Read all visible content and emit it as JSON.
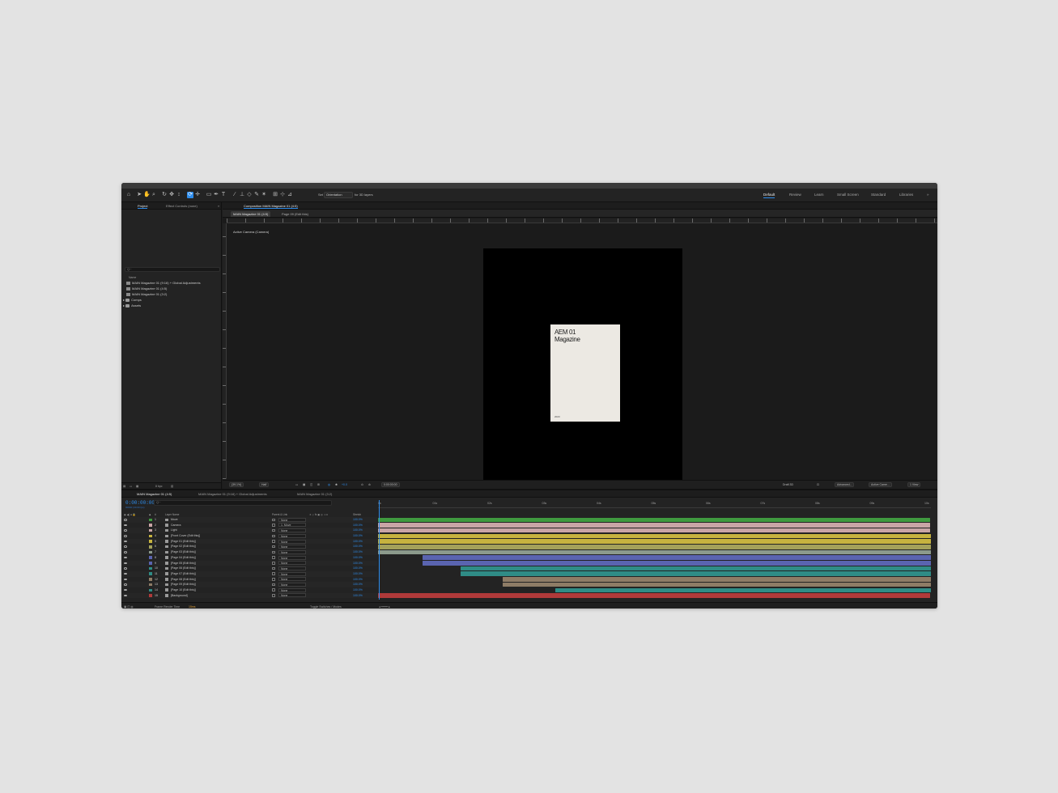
{
  "toolbar": {
    "mode_label": "Set",
    "mode_select": "Orientation",
    "mode_suffix": "for 3D layers"
  },
  "workspaces": [
    {
      "label": "Default",
      "active": true
    },
    {
      "label": "Review",
      "active": false
    },
    {
      "label": "Learn",
      "active": false
    },
    {
      "label": "Small Screen",
      "active": false
    },
    {
      "label": "Standard",
      "active": false
    },
    {
      "label": "Libraries",
      "active": false
    }
  ],
  "project": {
    "tab_project": "Project",
    "tab_effects": "Effect Controls (none)",
    "search_placeholder": "Q~",
    "name_header": "Name",
    "items": [
      {
        "label": "MAIN Magazine 01 (9:16) + Global Adjustments",
        "type": "comp"
      },
      {
        "label": "MAIN Magazine 01 (4:5)",
        "type": "comp"
      },
      {
        "label": "MAIN Magazine 01 (3:2)",
        "type": "comp"
      },
      {
        "label": "Comps",
        "type": "folder"
      },
      {
        "label": "Assets",
        "type": "folder"
      }
    ],
    "foot_bpc": "8 bpc"
  },
  "composition": {
    "panel_title": "Composition MAIN Magazine 01 (4:5)",
    "subtabs": [
      {
        "label": "MAIN Magazine 01 (4:5)",
        "active": true
      },
      {
        "label": "Page 09 (Edit this)",
        "active": false
      }
    ],
    "viewer_label": "Active Camera (Camera)",
    "magazine_title_1": "AEM 01",
    "magazine_title_2": "Magazine",
    "magazine_footer": "2023",
    "footer": {
      "zoom": "(39.1%)",
      "resolution": "Half",
      "offset": "+0.0",
      "timecode": "0:00:00:00",
      "renderer": "Draft 3D",
      "advanced": "Advanced...",
      "view": "Active Came...",
      "views": "1 View"
    }
  },
  "timeline": {
    "tabs": [
      {
        "label": "MAIN Magazine 01 (4:5)",
        "active": true
      },
      {
        "label": "MAIN Magazine 01 (9:16) + Global Adjustments",
        "active": false
      },
      {
        "label": "MAIN Magazine 01 (3:2)",
        "active": false
      }
    ],
    "timecode": "0:00:00:00",
    "fps": "00000 (30.00 fps)",
    "search_placeholder": "Q~",
    "headers": {
      "layer_name": "Layer Name",
      "parent": "Parent & Link",
      "stretch": "Stretch"
    },
    "ticks": [
      "0s",
      "01s",
      "02s",
      "03s",
      "04s",
      "05s",
      "06s",
      "07s",
      "08s",
      "09s",
      "10s"
    ],
    "layers": [
      {
        "num": "1",
        "name": "Move",
        "parent": "None",
        "stretch": "100.0%",
        "color": "#3f9a3f",
        "start": 0.0,
        "end": 0.998
      },
      {
        "num": "2",
        "name": "Camera",
        "parent": "1. Move",
        "stretch": "100.0%",
        "color": "#c9a5a6",
        "start": 0.0,
        "end": 0.998
      },
      {
        "num": "3",
        "name": "Light",
        "parent": "None",
        "stretch": "100.0%",
        "color": "#c9a5a6",
        "start": 0.0,
        "end": 0.998
      },
      {
        "num": "4",
        "name": "[Front Cover (Edit this)]",
        "parent": "None",
        "stretch": "100.0%",
        "color": "#c6b33f",
        "start": 0.0,
        "end": 1.0
      },
      {
        "num": "5",
        "name": "[Page 01 (Edit this)]",
        "parent": "None",
        "stretch": "100.0%",
        "color": "#c6b33f",
        "start": 0.0,
        "end": 1.0
      },
      {
        "num": "6",
        "name": "[Page 02 (Edit this)]",
        "parent": "None",
        "stretch": "100.0%",
        "color": "#a3a15a",
        "start": 0.0,
        "end": 1.0
      },
      {
        "num": "7",
        "name": "[Page 03 (Edit this)]",
        "parent": "None",
        "stretch": "100.0%",
        "color": "#8c9a8c",
        "start": 0.0,
        "end": 1.0
      },
      {
        "num": "8",
        "name": "[Page 04 (Edit this)]",
        "parent": "None",
        "stretch": "100.0%",
        "color": "#5a64b0",
        "start": 0.08,
        "end": 1.0
      },
      {
        "num": "9",
        "name": "[Page 05 (Edit this)]",
        "parent": "None",
        "stretch": "100.0%",
        "color": "#5a64b0",
        "start": 0.08,
        "end": 1.0
      },
      {
        "num": "10",
        "name": "[Page 06 (Edit this)]",
        "parent": "None",
        "stretch": "100.0%",
        "color": "#2f8c86",
        "start": 0.15,
        "end": 1.0
      },
      {
        "num": "11",
        "name": "[Page 07 (Edit this)]",
        "parent": "None",
        "stretch": "100.0%",
        "color": "#2f8c86",
        "start": 0.15,
        "end": 1.0
      },
      {
        "num": "12",
        "name": "[Page 08 (Edit this)]",
        "parent": "None",
        "stretch": "100.0%",
        "color": "#8e7c66",
        "start": 0.225,
        "end": 1.0
      },
      {
        "num": "13",
        "name": "[Page 09 (Edit this)]",
        "parent": "None",
        "stretch": "100.0%",
        "color": "#8e7c66",
        "start": 0.225,
        "end": 1.0
      },
      {
        "num": "14",
        "name": "[Page 10 (Edit this)]",
        "parent": "None",
        "stretch": "100.0%",
        "color": "#2f8c86",
        "start": 0.32,
        "end": 1.0
      },
      {
        "num": "15",
        "name": "[Background]",
        "parent": "None",
        "stretch": "100.0%",
        "color": "#b03a3a",
        "start": 0.0,
        "end": 0.998
      }
    ],
    "footer": {
      "render_label": "Frame Render Time",
      "render_value": "15ms",
      "toggle": "Toggle Switches / Modes"
    }
  }
}
